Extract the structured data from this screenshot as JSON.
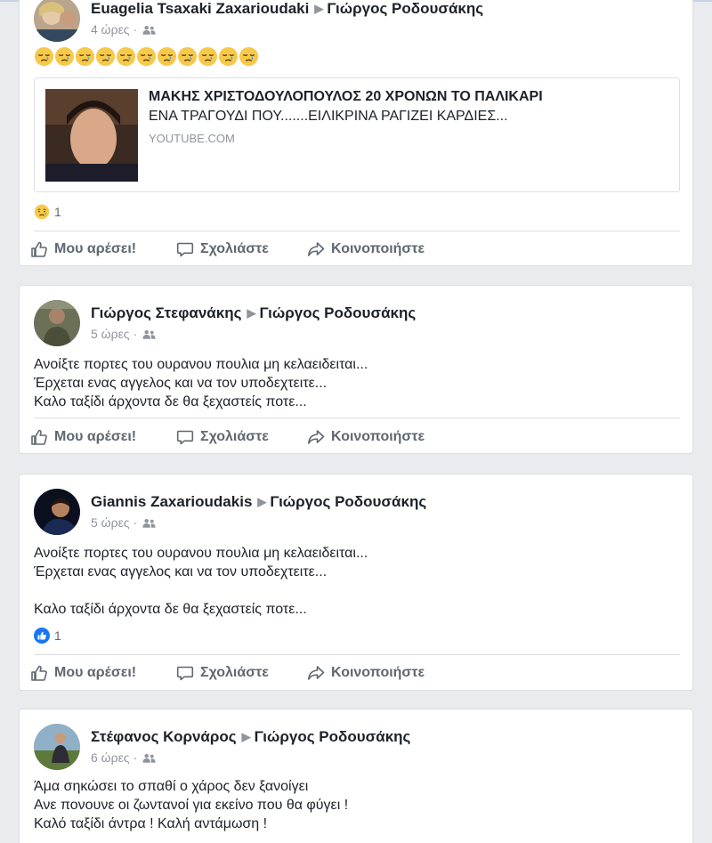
{
  "colors": {
    "background": "#e9ebee",
    "card": "#ffffff",
    "text": "#1d2129",
    "muted": "#90949c",
    "action": "#606770",
    "like_blue": "#1877f2"
  },
  "actions": {
    "like": "Μου αρέσει!",
    "comment": "Σχολιάστε",
    "share": "Κοινοποιήστε"
  },
  "posts": [
    {
      "author": "Euagelia Tsaxaki Zaxarioudaki",
      "target": "Γιώργος Ροδουσάκης",
      "time": "4 ώρες",
      "audience_icon": "friends-icon",
      "emojis": "😪😪😪😪😪😪😪😪😪😪😪",
      "link": {
        "title": "ΜΑΚΗΣ ΧΡΙΣΤΟΔΟΥΛΟΠΟΥΛΟΣ 20 ΧΡΟΝΩΝ ΤΟ ΠΑΛΙΚΑΡΙ",
        "description": "ΕΝΑ ΤΡΑΓΟΥΔΙ ΠΟΥ.......ΕΙΛΙΚΡΙΝΑ ΡΑΓΙΖΕΙ ΚΑΡΔΙΕΣ...",
        "source": "YOUTUBE.COM"
      },
      "reaction_icon": "sad-reaction-icon",
      "reaction_count": "1"
    },
    {
      "author": "Γιώργος Στεφανάκης",
      "target": "Γιώργος Ροδουσάκης",
      "time": "5 ώρες",
      "audience_icon": "friends-icon",
      "text": "Ανοίξτε πορτες του ουρανου πουλια μη κελαειδειται...\nΈρχεται ενας αγγελος και να τον υποδεχτειτε...\nΚαλο ταξίδι άρχοντα δε θα ξεχαστείς ποτε..."
    },
    {
      "author": "Giannis Zaxarioudakis",
      "target": "Γιώργος Ροδουσάκης",
      "time": "5 ώρες",
      "audience_icon": "friends-icon",
      "text": "Ανοίξτε πορτες του ουρανου πουλια μη κελαειδειται...\nΈρχεται ενας αγγελος και να τον υποδεχτειτε...\n\nΚαλο ταξίδι άρχοντα δε θα ξεχαστείς ποτε...",
      "reaction_icon": "like-reaction-icon",
      "reaction_count": "1"
    },
    {
      "author": "Στέφανος Κορνάρος",
      "target": "Γιώργος Ροδουσάκης",
      "time": "6 ώρες",
      "audience_icon": "friends-icon",
      "text": "Άμα σηκώσει το σπαθί ο χάρος δεν ξανοίγει\nΑνε πονουνε οι ζωντανοί για εκείνο που θα φύγει !\nΚαλό ταξίδι άντρα ! Καλή αντάμωση !"
    }
  ]
}
